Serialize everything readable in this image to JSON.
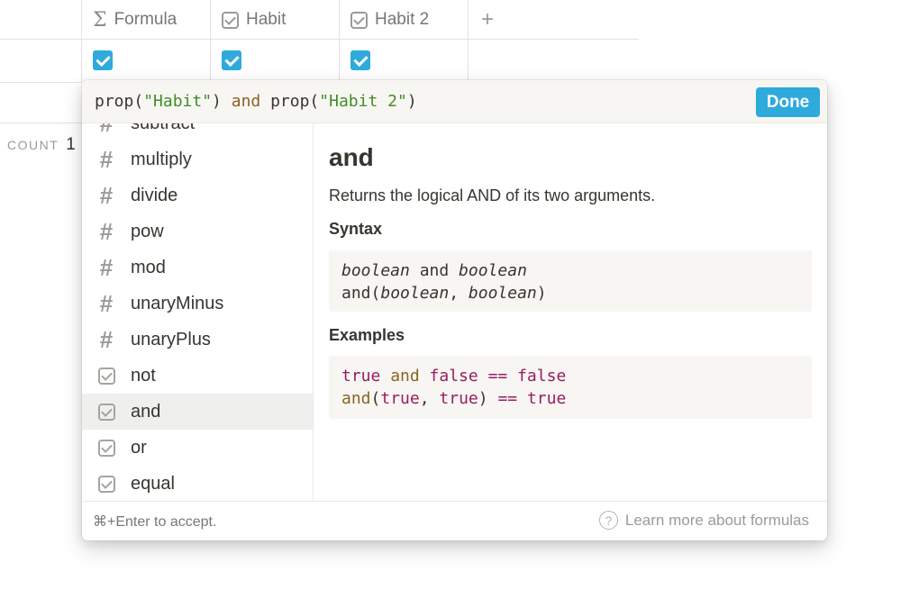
{
  "table": {
    "columns": [
      {
        "icon": "sigma-icon",
        "label": "Formula"
      },
      {
        "icon": "checkbox-icon",
        "label": "Habit"
      },
      {
        "icon": "checkbox-icon",
        "label": "Habit 2"
      }
    ],
    "add_column": "+",
    "row": {
      "formula": true,
      "habit": true,
      "habit2": true
    },
    "count_label": "COUNT",
    "count_value": "1"
  },
  "editor": {
    "expression_parts": [
      "prop(",
      "\"Habit\"",
      ") ",
      "and",
      " prop(",
      "\"Habit 2\"",
      ")"
    ],
    "done_label": "Done"
  },
  "function_list": {
    "items": [
      {
        "icon": "hash-icon",
        "label": "subtract"
      },
      {
        "icon": "hash-icon",
        "label": "multiply"
      },
      {
        "icon": "hash-icon",
        "label": "divide"
      },
      {
        "icon": "hash-icon",
        "label": "pow"
      },
      {
        "icon": "hash-icon",
        "label": "mod"
      },
      {
        "icon": "hash-icon",
        "label": "unaryMinus"
      },
      {
        "icon": "hash-icon",
        "label": "unaryPlus"
      },
      {
        "icon": "checkbox-icon",
        "label": "not"
      },
      {
        "icon": "checkbox-icon",
        "label": "and",
        "selected": true
      },
      {
        "icon": "checkbox-icon",
        "label": "or"
      },
      {
        "icon": "checkbox-icon",
        "label": "equal"
      }
    ]
  },
  "detail": {
    "title": "and",
    "description": "Returns the logical AND of its two arguments.",
    "syntax_heading": "Syntax",
    "syntax_line1": {
      "a": "boolean",
      "op": " and ",
      "b": "boolean"
    },
    "syntax_line2": {
      "fn": "and(",
      "a": "boolean",
      "sep": ", ",
      "b": "boolean",
      "end": ")"
    },
    "examples_heading": "Examples",
    "example1": {
      "a": "true",
      "op1": " and ",
      "b": "false",
      "op2": " == ",
      "c": "false"
    },
    "example2": {
      "fn": "and",
      "open": "(",
      "a": "true",
      "sep": ", ",
      "b": "true",
      "close": ")",
      "op": " == ",
      "c": "true"
    }
  },
  "footer": {
    "accept_hint": "⌘+Enter to accept.",
    "learn_more": "Learn more about formulas",
    "help_icon": "question-circle-icon"
  },
  "colors": {
    "accent": "#2eaadc",
    "string_token": "#448c27",
    "keyword_token": "#8a6320",
    "literal_token": "#9a1c61"
  }
}
